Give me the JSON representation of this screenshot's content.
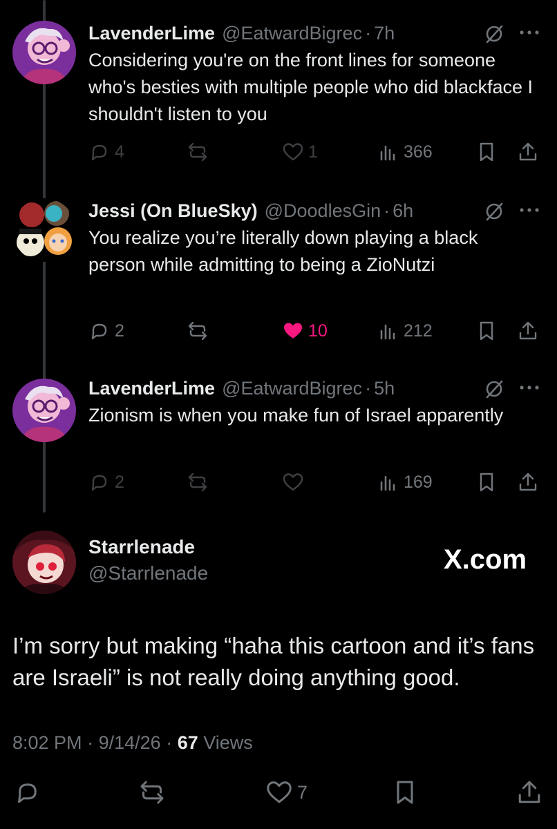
{
  "replies": [
    {
      "name": "LavenderLime",
      "handle": "@EatwardBigrec",
      "time": "7h",
      "text": "Considering you're on the front lines for someone who's besties with multiple people who did blackface I shouldn't listen to you",
      "replies": "4",
      "reposts": "",
      "likes": "1",
      "views": "366",
      "liked": false
    },
    {
      "name": "Jessi (On BlueSky)",
      "handle": "@DoodlesGin",
      "time": "6h",
      "text": "You realize you’re literally down playing a black person while admitting to being a ZioNutzi",
      "replies": "2",
      "reposts": "",
      "likes": "10",
      "views": "212",
      "liked": true
    },
    {
      "name": "LavenderLime",
      "handle": "@EatwardBigrec",
      "time": "5h",
      "text": "Zionism is when you make fun of Israel apparently",
      "replies": "2",
      "reposts": "",
      "likes": "",
      "views": "169",
      "liked": false
    }
  ],
  "main": {
    "name": "Starrlenade",
    "handle": "@Starrlenade",
    "watermark": "X.com",
    "text": "I’m sorry but making “haha this cartoon and it’s fans are Israeli” is not really doing anything good.",
    "time": "8:02 PM",
    "date": "9/14/26",
    "views": "67",
    "views_label": "Views",
    "likes": "7"
  },
  "colors": {
    "background": "#000000",
    "text": "#e7e9ea",
    "muted": "#71767b",
    "like": "#f91880",
    "thread_line": "#333639"
  },
  "icons": [
    "reply-icon",
    "repost-icon",
    "like-icon",
    "views-icon",
    "bookmark-icon",
    "share-icon",
    "grok-icon",
    "more-icon"
  ]
}
